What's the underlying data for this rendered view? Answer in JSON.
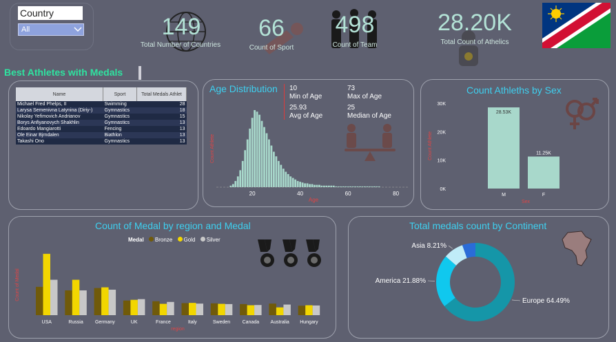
{
  "filter": {
    "label": "Country",
    "selected": "All"
  },
  "kpis": [
    {
      "value": "149",
      "label": "Total Number of Countries"
    },
    {
      "value": "66",
      "label": "Count of Sport"
    },
    {
      "value": "498",
      "label": "Count of Team"
    },
    {
      "value": "28.20K",
      "label": "Total Count of Athelics"
    }
  ],
  "best_athletes": {
    "title": "Best Athletes with Medals",
    "columns": [
      "Name",
      "Sport",
      "Total Medals Athlet"
    ],
    "rows": [
      [
        "Michael Fred Phelps, II",
        "Swimming",
        "28"
      ],
      [
        "Larysa Semenivna Latynina (Diriy-)",
        "Gymnastics",
        "18"
      ],
      [
        "Nikolay Yefimovich Andrianov",
        "Gymnastics",
        "15"
      ],
      [
        "Borys Anfiyanovych Shakhlin",
        "Gymnastics",
        "13"
      ],
      [
        "Edoardo Mangiarotti",
        "Fencing",
        "13"
      ],
      [
        "Ole Einar Bjrndalen",
        "Biathlon",
        "13"
      ],
      [
        "Takashi Ono",
        "Gymnastics",
        "13"
      ]
    ]
  },
  "age": {
    "title": "Age Distribution",
    "stats": [
      {
        "value": "10",
        "label": "Min of Age"
      },
      {
        "value": "73",
        "label": "Max of Age"
      },
      {
        "value": "25.93",
        "label": "Avg of Age"
      },
      {
        "value": "25",
        "label": "Median of Age"
      }
    ],
    "xlabel": "Age",
    "ylabel": "Count Athlete",
    "ticks": [
      "20",
      "40",
      "60",
      "80"
    ]
  },
  "sex": {
    "title": "Count Athleths by Sex",
    "xlabel": "Sex",
    "ylabel": "Count Athlete",
    "yticks": [
      "30K",
      "20K",
      "10K",
      "0K"
    ]
  },
  "medal_region": {
    "title": "Count of Medal by region and Medal",
    "xlabel": "region",
    "ylabel": "Count of Medal",
    "legend_title": "Medal"
  },
  "continent": {
    "title": "Total medals count by Continent"
  },
  "colors": {
    "bronze": "#705a0a",
    "gold": "#f2d600",
    "silver": "#c8c8c8",
    "mint": "#a8d8cb",
    "cyan": "#3ed0f0"
  },
  "chart_data": [
    {
      "type": "bar",
      "title": "Age Distribution",
      "xlabel": "Age",
      "ylabel": "Count Athlete",
      "x": [
        11,
        12,
        13,
        14,
        15,
        16,
        17,
        18,
        19,
        20,
        21,
        22,
        23,
        24,
        25,
        26,
        27,
        28,
        29,
        30,
        31,
        32,
        33,
        34,
        35,
        36,
        37,
        38,
        39,
        40,
        41,
        42,
        43,
        44,
        45,
        46,
        47,
        48,
        49,
        50,
        51,
        52,
        53,
        54,
        55,
        56,
        57,
        58,
        59,
        60,
        61,
        62,
        63,
        64,
        65,
        66,
        67,
        68,
        69,
        70,
        71,
        72,
        73
      ],
      "values": [
        2,
        4,
        8,
        14,
        22,
        34,
        48,
        62,
        76,
        90,
        100,
        98,
        94,
        86,
        78,
        70,
        62,
        54,
        46,
        40,
        34,
        29,
        24,
        20,
        17,
        14,
        12,
        10,
        8,
        7,
        6,
        5,
        5,
        4,
        4,
        3,
        3,
        3,
        2,
        2,
        2,
        2,
        2,
        2,
        1,
        1,
        1,
        1,
        1,
        1,
        1,
        1,
        1,
        1,
        1,
        1,
        1,
        1,
        1,
        1,
        1,
        1,
        1
      ],
      "xlim": [
        5,
        85
      ]
    },
    {
      "type": "bar",
      "title": "Count Athleths by Sex",
      "xlabel": "Sex",
      "ylabel": "Count Athlete",
      "categories": [
        "M",
        "F"
      ],
      "values": [
        28530,
        11250
      ],
      "data_labels": [
        "28.53K",
        "11.25K"
      ],
      "ylim": [
        0,
        30000
      ]
    },
    {
      "type": "bar",
      "title": "Count of Medal by region and Medal",
      "xlabel": "region",
      "ylabel": "Count of Medal",
      "categories": [
        "USA",
        "Russia",
        "Germany",
        "UK",
        "France",
        "Italy",
        "Sweden",
        "Canada",
        "Australia",
        "Hungary"
      ],
      "series": [
        {
          "name": "Bronze",
          "values": [
            1200,
            1050,
            1150,
            620,
            590,
            510,
            500,
            470,
            490,
            400
          ]
        },
        {
          "name": "Gold",
          "values": [
            2600,
            1500,
            1180,
            650,
            480,
            520,
            480,
            420,
            330,
            420
          ]
        },
        {
          "name": "Silver",
          "values": [
            1500,
            1050,
            1080,
            680,
            560,
            490,
            470,
            430,
            450,
            410
          ]
        }
      ],
      "ymax": 2800
    },
    {
      "type": "pie",
      "title": "Total medals count by Continent",
      "categories": [
        "Europe",
        "America",
        "Asia",
        "Other"
      ],
      "values": [
        64.49,
        21.88,
        8.21,
        5.42
      ],
      "labels": [
        "Europe 64.49%",
        "America 21.88%",
        "Asia 8.21%",
        ""
      ]
    }
  ]
}
